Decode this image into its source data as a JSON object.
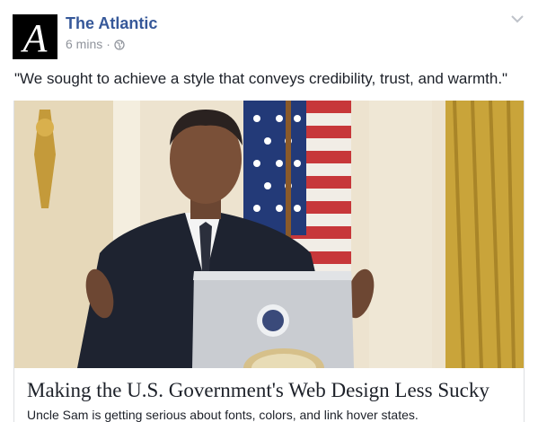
{
  "post": {
    "page_name": "The Atlantic",
    "avatar_letter": "A",
    "time_ago": "6 mins",
    "separator": "·",
    "audience_icon": "globe-icon",
    "menu_icon": "chevron-down-icon",
    "message": "\"We sought to achieve a style that conveys credibility, trust, and warmth.\""
  },
  "link_card": {
    "title": "Making the U.S. Government's Web Design Less Sucky",
    "description": "Uncle Sam is getting serious about fonts, colors, and link hover states."
  },
  "colors": {
    "page_name": "#365899",
    "meta_text": "#90949c",
    "body_text": "#1d2129"
  }
}
